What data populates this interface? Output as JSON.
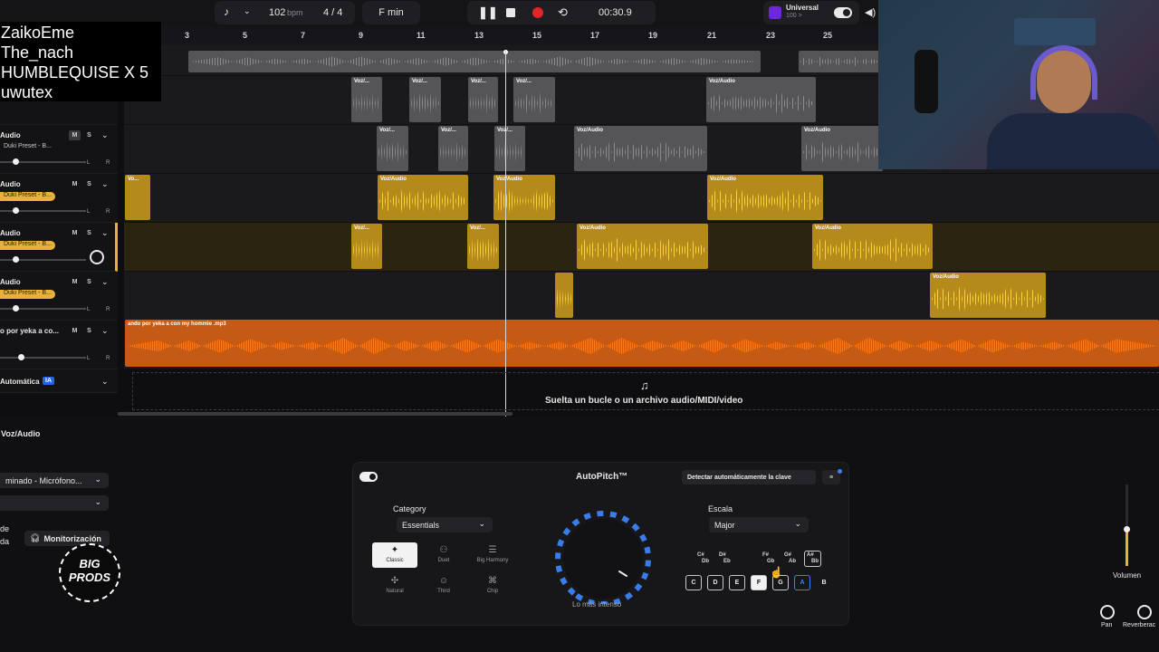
{
  "transport": {
    "bpm_value": "102",
    "bpm_unit": "bpm",
    "time_signature": "4 / 4",
    "key": "F min",
    "time": "00:30.9",
    "instrument_name": "Universal",
    "instrument_sub": "100 >"
  },
  "ruler": {
    "ticks": [
      "3",
      "5",
      "7",
      "9",
      "11",
      "13",
      "15",
      "17",
      "19",
      "21",
      "23",
      "25"
    ]
  },
  "overlay_names": [
    "ZaikoEme",
    "The_nach",
    "HUMBLEQUISE X 5",
    "uwutex"
  ],
  "tracks": [
    {
      "name": "Audio",
      "preset": "Duki Preset - B..."
    },
    {
      "name": "Audio",
      "preset": "Duki Preset - B..."
    },
    {
      "name": "Audio",
      "preset": "Duki Preset - B..."
    },
    {
      "name": "Audio",
      "preset": "Duki Preset - B..."
    },
    {
      "name": "o por yeka a co...",
      "preset": ""
    }
  ],
  "mute_label": "M",
  "solo_label": "S",
  "pan_left": "L",
  "pan_right": "R",
  "clip_labels": {
    "voz_short": "Voz/...",
    "voz_audio": "Voz/Audio",
    "voz_tiny": "Vo...",
    "mp3": "ando por yeka a con my hommie .mp3"
  },
  "automation": {
    "label": "Automática",
    "badge": "IA"
  },
  "dropzone_text": "Suelta un bucle o un archivo audio/MIDI/video",
  "bottom": {
    "track_title": "Voz/Audio",
    "input_device": "minado - Micrófono...",
    "left_label_1": "de",
    "left_label_2": "da",
    "monitor_button": "Monitorización",
    "logo_text_1": "BIG",
    "logo_text_2": "PRODS"
  },
  "autopitch": {
    "title": "AutoPitch™",
    "detect_key_button": "Detectar automáticamente la clave",
    "category_label": "Category",
    "category_value": "Essentials",
    "presets": [
      "Classic",
      "Duet",
      "Big Harmony",
      "Natural",
      "Third",
      "Chip"
    ],
    "active_preset": "Classic",
    "dial_label": "Lo más intenso",
    "scale_label": "Escala",
    "scale_value": "Major",
    "sharps": [
      {
        "top": "C#",
        "bottom": "Db"
      },
      {
        "top": "D#",
        "bottom": "Eb"
      },
      {
        "top": "F#",
        "bottom": "Gb"
      },
      {
        "top": "G#",
        "bottom": "Ab"
      },
      {
        "top": "A#",
        "bottom": "Bb"
      }
    ],
    "naturals": [
      "C",
      "D",
      "E",
      "F",
      "G",
      "A",
      "B"
    ],
    "selected_key": "F",
    "accent_color": "#3b82f6"
  },
  "mixer": {
    "volume_label": "Volumen",
    "pan_label": "Pan",
    "reverb_label": "Reverberac"
  },
  "colors": {
    "gold_clip": "#b48a1a",
    "orange_clip": "#c45a14",
    "record_red": "#e0262b",
    "preset_badge": "#e8b13a"
  }
}
